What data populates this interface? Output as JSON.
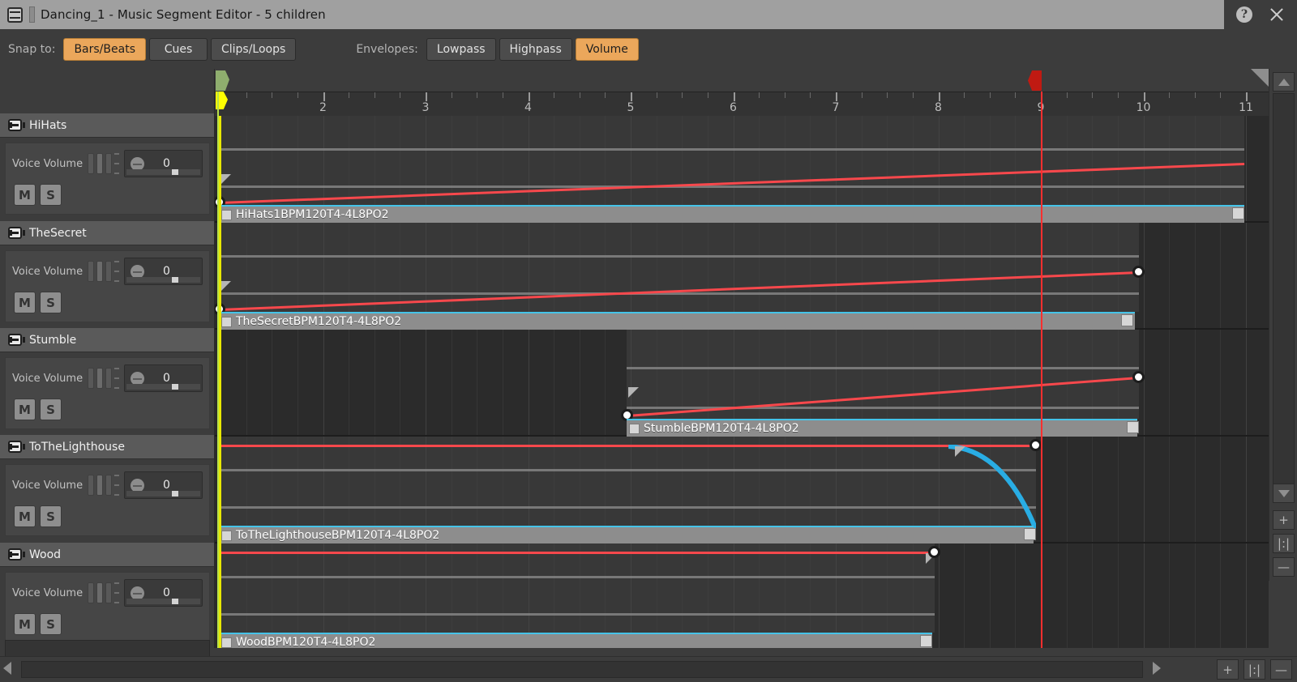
{
  "window": {
    "title": "Dancing_1 - Music Segment Editor - 5 children",
    "icon": "segment-editor-icon",
    "help_label": "?",
    "close_label": "✕"
  },
  "toolbar": {
    "snap_label": "Snap to:",
    "snap_options": [
      "Bars/Beats",
      "Cues",
      "Clips/Loops"
    ],
    "snap_active": "Bars/Beats",
    "envelopes_label": "Envelopes:",
    "envelope_options": [
      "Lowpass",
      "Highpass",
      "Volume"
    ],
    "envelope_active": "Volume",
    "accent_color": "#eba75b"
  },
  "ruler": {
    "bars": [
      "2",
      "3",
      "4",
      "5",
      "6",
      "7",
      "8",
      "9",
      "10",
      "11"
    ],
    "playhead_bar": "9",
    "start_marker": "segment-start",
    "end_marker": "segment-end"
  },
  "tracks": [
    {
      "name": "HiHats",
      "volume_label": "Voice Volume",
      "volume_value": "0",
      "mute_label": "M",
      "solo_label": "S",
      "clip_label": "HiHats1BPM120T4-4L8PO2"
    },
    {
      "name": "TheSecret",
      "volume_label": "Voice Volume",
      "volume_value": "0",
      "mute_label": "M",
      "solo_label": "S",
      "clip_label": "TheSecretBPM120T4-4L8PO2"
    },
    {
      "name": "Stumble",
      "volume_label": "Voice Volume",
      "volume_value": "0",
      "mute_label": "M",
      "solo_label": "S",
      "clip_label": "StumbleBPM120T4-4L8PO2"
    },
    {
      "name": "ToTheLighthouse",
      "volume_label": "Voice Volume",
      "volume_value": "0",
      "mute_label": "M",
      "solo_label": "S",
      "clip_label": "ToTheLighthouseBPM120T4-4L8PO2"
    },
    {
      "name": "Wood",
      "volume_label": "Voice Volume",
      "volume_value": "0",
      "mute_label": "M",
      "solo_label": "S",
      "clip_label": "WoodBPM120T4-4L8PO2"
    }
  ],
  "scroll": {
    "up_arrow": "▲",
    "down_arrow": "▼",
    "left_arrow": "◀",
    "right_arrow": "▶",
    "zoom_in": "+",
    "zoom_fit": "|:|",
    "zoom_out": "—"
  },
  "colors": {
    "envelope_red": "#f8484c",
    "fade_blue": "#29ade4",
    "clip_border": "#45c3e8",
    "playhead": "#ff2f2f",
    "start_green": "#b9e04a",
    "start_yellow": "#e8e800",
    "end_red": "#c01a12"
  }
}
